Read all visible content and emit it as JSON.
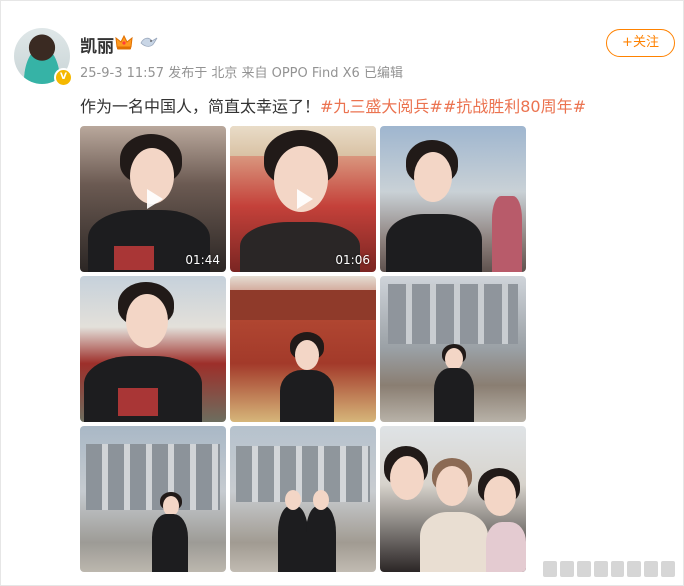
{
  "post": {
    "username": "凯丽",
    "meta": "25-9-3 11:57 发布于 北京  来自 OPPO Find X6 已编辑",
    "follow_label": "+关注",
    "text_plain": "作为一名中国人，简直太幸运了！",
    "tag1": "#九三盛大阅兵#",
    "tag2": "#抗战胜利80周年#",
    "verified_badge": "V"
  },
  "media": {
    "thumbs": [
      {
        "kind": "video",
        "duration": "01:44",
        "scene": "selfie-crowd"
      },
      {
        "kind": "video",
        "duration": "01:06",
        "scene": "selfie-red"
      },
      {
        "kind": "image",
        "scene": "selfie-crowd-sky"
      },
      {
        "kind": "image",
        "scene": "palace-wall"
      },
      {
        "kind": "image",
        "scene": "tiananmen-gate"
      },
      {
        "kind": "image",
        "scene": "hall-front"
      },
      {
        "kind": "image",
        "scene": "hall-front-left"
      },
      {
        "kind": "image",
        "scene": "hall-two-women"
      },
      {
        "kind": "image",
        "scene": "three-women"
      }
    ]
  },
  "icons": {
    "crown": "crown-icon",
    "bird": "bird-icon",
    "play": "play-icon",
    "verified": "verified-badge-icon"
  },
  "colors": {
    "accent": "#ff8200",
    "tag": "#eb7350",
    "meta": "#939393"
  }
}
